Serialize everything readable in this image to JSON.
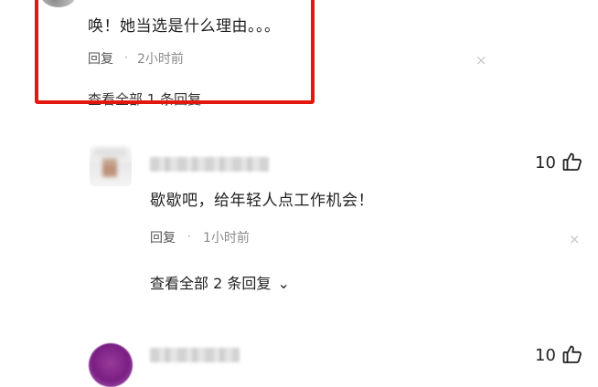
{
  "comments": [
    {
      "text": "唤！她当选是什么理由。。。",
      "reply_label": "回复",
      "separator": "·",
      "time": "2小时前",
      "close_glyph": "×",
      "view_replies": "查看全部 1 条回复"
    },
    {
      "text": "歇歇吧，给年轻人点工作机会！",
      "reply_label": "回复",
      "separator": "·",
      "time": "1小时前",
      "close_glyph": "×",
      "like_count": "10",
      "view_replies": "查看全部 2 条回复",
      "chevron": "⌄"
    },
    {
      "like_count": "10"
    }
  ],
  "colors": {
    "highlight_border": "#e3170f",
    "text": "#1f1f1f",
    "meta": "#8a8a8a"
  },
  "icons": {
    "like": "thumbs-up-icon",
    "close": "close-icon",
    "chevron": "chevron-down-icon"
  }
}
